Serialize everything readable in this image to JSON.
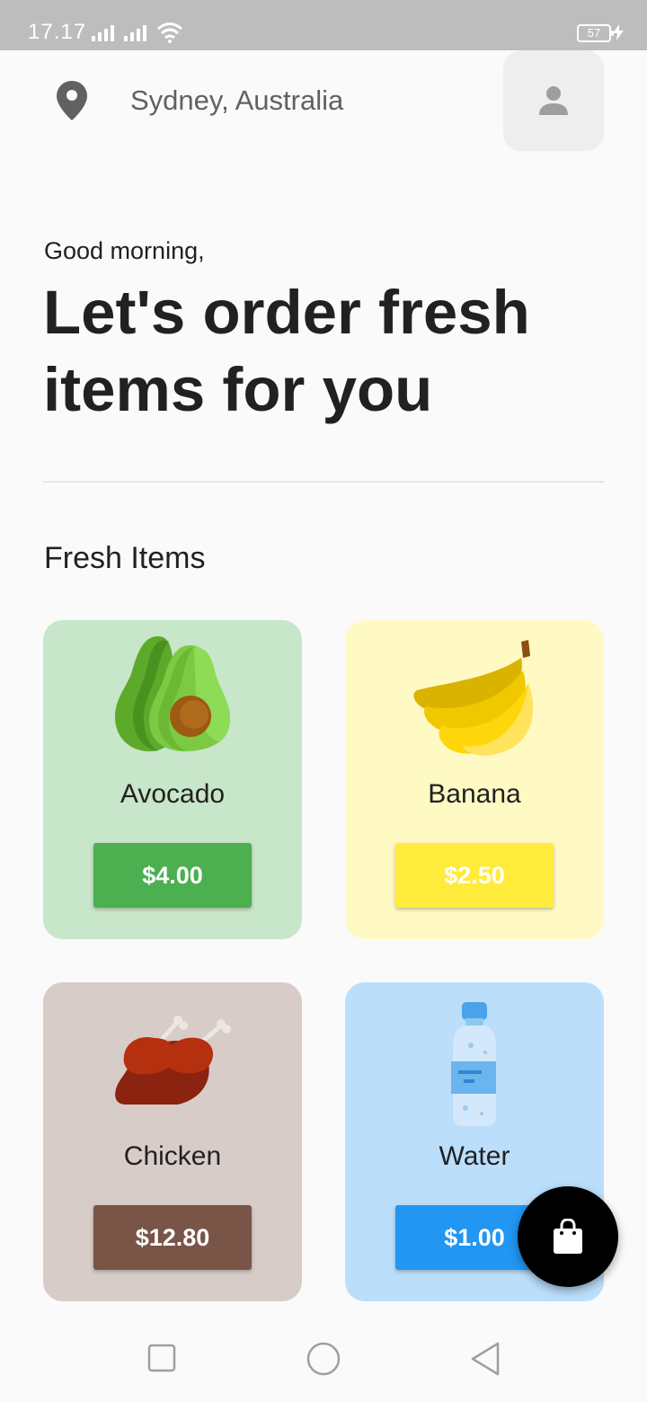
{
  "status_bar": {
    "time": "17.17",
    "battery": "57"
  },
  "header": {
    "location": "Sydney, Australia",
    "location_icon": "location-pin-icon",
    "profile_icon": "person-icon"
  },
  "greeting": "Good morning,",
  "headline": "Let's order fresh items for you",
  "section_title": "Fresh Items",
  "items": [
    {
      "name": "Avocado",
      "price": "$4.00",
      "icon": "avocado-icon",
      "bg": "#c8e6c9",
      "button": "#4caf50"
    },
    {
      "name": "Banana",
      "price": "$2.50",
      "icon": "banana-icon",
      "bg": "#fff9c4",
      "button": "#ffeb3b"
    },
    {
      "name": "Chicken",
      "price": "$12.80",
      "icon": "chicken-icon",
      "bg": "#d7ccc8",
      "button": "#795548"
    },
    {
      "name": "Water",
      "price": "$1.00",
      "icon": "water-bottle-icon",
      "bg": "#bbdefb",
      "button": "#2196f3"
    }
  ],
  "fab": {
    "icon": "shopping-bag-icon"
  },
  "nav": {
    "recents": "square-icon",
    "home": "circle-icon",
    "back": "triangle-back-icon"
  }
}
